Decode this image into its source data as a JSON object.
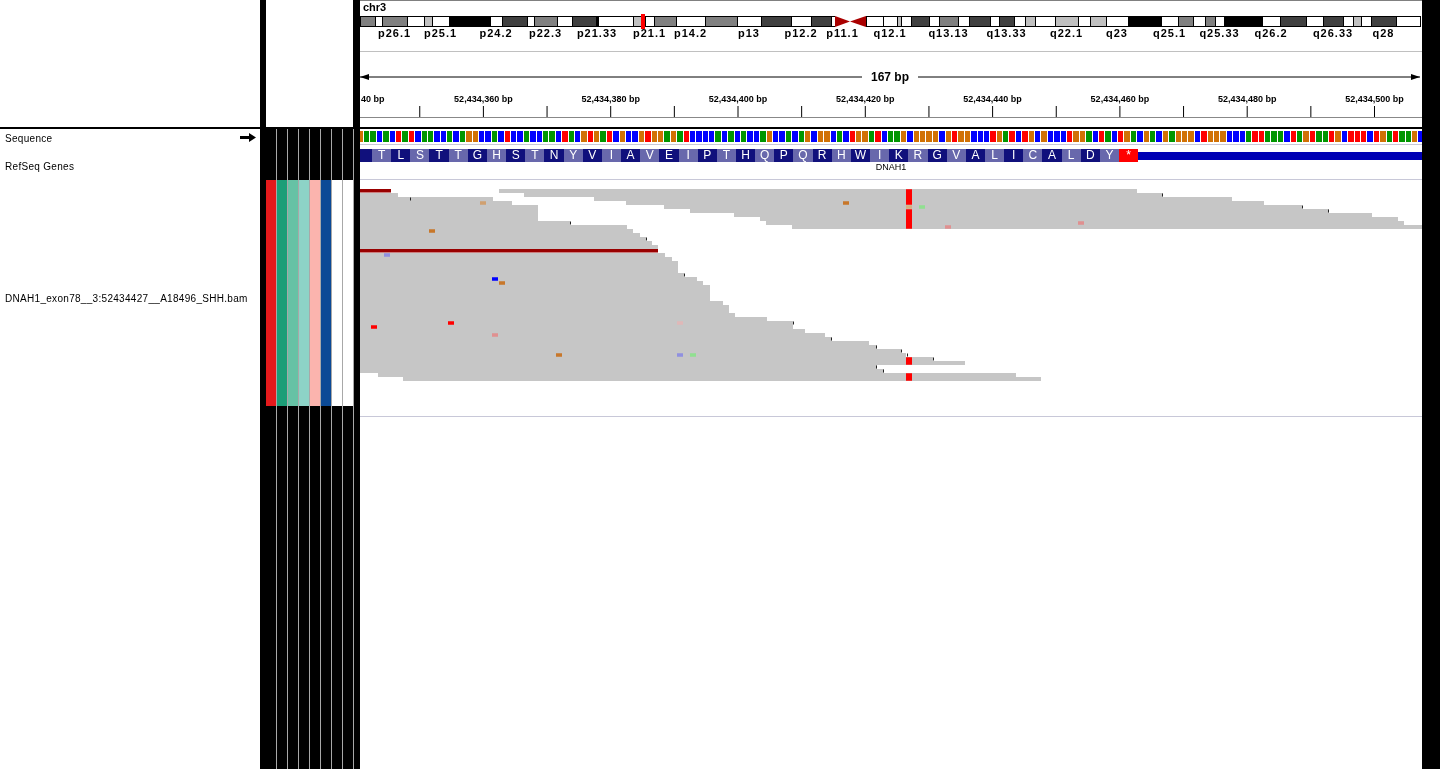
{
  "ideogram": {
    "chromosome": "chr3",
    "bands": [
      {
        "kind": "band",
        "color": "#808080"
      },
      {
        "kind": "band",
        "color": "#ffffff"
      },
      {
        "kind": "band",
        "color": "#808080",
        "label": "p26.1"
      },
      {
        "kind": "band",
        "color": "#ffffff"
      },
      {
        "kind": "band",
        "color": "#c0c0c0"
      },
      {
        "kind": "band",
        "color": "#ffffff",
        "label": "p25.1"
      },
      {
        "kind": "band",
        "color": "#000000"
      },
      {
        "kind": "band",
        "color": "#ffffff",
        "label": "p24.2"
      },
      {
        "kind": "band",
        "color": "#404040"
      },
      {
        "kind": "band",
        "color": "#ffffff"
      },
      {
        "kind": "band",
        "color": "#808080",
        "label": "p22.3"
      },
      {
        "kind": "band",
        "color": "#ffffff"
      },
      {
        "kind": "band",
        "color": "#404040"
      },
      {
        "kind": "band",
        "color": "#000000",
        "label": "p21.33"
      },
      {
        "kind": "band",
        "color": "#ffffff"
      },
      {
        "kind": "band",
        "color": "#c0c0c0"
      },
      {
        "kind": "marker",
        "color": "#ff0000"
      },
      {
        "kind": "band",
        "color": "#ffffff",
        "label": "p21.1"
      },
      {
        "kind": "band",
        "color": "#808080"
      },
      {
        "kind": "band",
        "color": "#ffffff",
        "label": "p14.2"
      },
      {
        "kind": "band",
        "color": "#808080"
      },
      {
        "kind": "band",
        "color": "#ffffff",
        "label": "p13"
      },
      {
        "kind": "band",
        "color": "#404040"
      },
      {
        "kind": "band",
        "color": "#ffffff",
        "label": "p12.2"
      },
      {
        "kind": "band",
        "color": "#404040"
      },
      {
        "kind": "band",
        "color": "#ffffff"
      },
      {
        "kind": "centromere_p",
        "color": "#aa0000",
        "label": "p11.1"
      },
      {
        "kind": "centromere_q",
        "color": "#aa0000"
      },
      {
        "kind": "band",
        "color": "#ffffff"
      },
      {
        "kind": "band",
        "color": "#ffffff",
        "label": "q12.1"
      },
      {
        "kind": "band",
        "color": "#c0c0c0"
      },
      {
        "kind": "band",
        "color": "#ffffff"
      },
      {
        "kind": "band",
        "color": "#404040"
      },
      {
        "kind": "band",
        "color": "#ffffff"
      },
      {
        "kind": "band",
        "color": "#808080",
        "label": "q13.13"
      },
      {
        "kind": "band",
        "color": "#ffffff"
      },
      {
        "kind": "band",
        "color": "#404040"
      },
      {
        "kind": "band",
        "color": "#ffffff"
      },
      {
        "kind": "band",
        "color": "#404040",
        "label": "q13.33"
      },
      {
        "kind": "band",
        "color": "#ffffff"
      },
      {
        "kind": "band",
        "color": "#c0c0c0"
      },
      {
        "kind": "band",
        "color": "#ffffff"
      },
      {
        "kind": "band",
        "color": "#c0c0c0",
        "label": "q22.1"
      },
      {
        "kind": "band",
        "color": "#ffffff"
      },
      {
        "kind": "band",
        "color": "#c0c0c0"
      },
      {
        "kind": "band",
        "color": "#ffffff",
        "label": "q23"
      },
      {
        "kind": "band",
        "color": "#000000"
      },
      {
        "kind": "band",
        "color": "#ffffff",
        "label": "q25.1"
      },
      {
        "kind": "band",
        "color": "#808080"
      },
      {
        "kind": "band",
        "color": "#ffffff"
      },
      {
        "kind": "band",
        "color": "#808080"
      },
      {
        "kind": "band",
        "color": "#ffffff",
        "label": "q25.33"
      },
      {
        "kind": "band",
        "color": "#000000"
      },
      {
        "kind": "band",
        "color": "#ffffff",
        "label": "q26.2"
      },
      {
        "kind": "band",
        "color": "#404040"
      },
      {
        "kind": "band",
        "color": "#ffffff"
      },
      {
        "kind": "band",
        "color": "#404040",
        "label": "q26.33"
      },
      {
        "kind": "band",
        "color": "#ffffff"
      },
      {
        "kind": "band",
        "color": "#c0c0c0"
      },
      {
        "kind": "band",
        "color": "#ffffff"
      },
      {
        "kind": "band",
        "color": "#404040",
        "label": "q28"
      },
      {
        "kind": "band",
        "color": "#ffffff"
      }
    ]
  },
  "ruler": {
    "span": "167 bp",
    "ticks": [
      "40 bp",
      "52,434,360 bp",
      "52,434,380 bp",
      "52,434,400 bp",
      "52,434,420 bp",
      "52,434,440 bp",
      "52,434,460 bp",
      "52,434,480 bp",
      "52,434,500 bp"
    ]
  },
  "sequence_track": {
    "name": "Sequence",
    "forward_strand": true,
    "bases": [
      {
        "color": "#d17105"
      },
      {
        "color": "#009600"
      },
      {
        "color": "#009600"
      },
      {
        "color": "#0000ff"
      },
      {
        "color": "#009600"
      },
      {
        "color": "#0000ff"
      },
      {
        "color": "#ff0000"
      },
      {
        "color": "#009600"
      },
      {
        "color": "#ff0000"
      },
      {
        "color": "#0000ff"
      },
      {
        "color": "#009600"
      },
      {
        "color": "#009600"
      },
      {
        "color": "#0000ff"
      },
      {
        "color": "#0000ff"
      },
      {
        "color": "#009600"
      },
      {
        "color": "#0000ff"
      },
      {
        "color": "#009600"
      },
      {
        "color": "#d17105"
      },
      {
        "color": "#d17105"
      },
      {
        "color": "#0000ff"
      },
      {
        "color": "#0000ff"
      },
      {
        "color": "#009600"
      },
      {
        "color": "#0000ff"
      },
      {
        "color": "#ff0000"
      },
      {
        "color": "#0000ff"
      },
      {
        "color": "#0000ff"
      },
      {
        "color": "#009600"
      },
      {
        "color": "#0000ff"
      },
      {
        "color": "#0000ff"
      },
      {
        "color": "#009600"
      },
      {
        "color": "#009600"
      },
      {
        "color": "#0000ff"
      },
      {
        "color": "#ff0000"
      },
      {
        "color": "#009600"
      },
      {
        "color": "#0000ff"
      },
      {
        "color": "#d17105"
      },
      {
        "color": "#ff0000"
      },
      {
        "color": "#d17105"
      },
      {
        "color": "#009600"
      },
      {
        "color": "#ff0000"
      },
      {
        "color": "#0000ff"
      },
      {
        "color": "#d17105"
      },
      {
        "color": "#0000ff"
      },
      {
        "color": "#0000ff"
      },
      {
        "color": "#d17105"
      },
      {
        "color": "#ff0000"
      },
      {
        "color": "#d17105"
      },
      {
        "color": "#d17105"
      },
      {
        "color": "#009600"
      },
      {
        "color": "#d17105"
      },
      {
        "color": "#009600"
      },
      {
        "color": "#ff0000"
      },
      {
        "color": "#0000ff"
      },
      {
        "color": "#0000ff"
      },
      {
        "color": "#0000ff"
      },
      {
        "color": "#0000ff"
      },
      {
        "color": "#009600"
      },
      {
        "color": "#0000ff"
      },
      {
        "color": "#009600"
      },
      {
        "color": "#0000ff"
      },
      {
        "color": "#009600"
      },
      {
        "color": "#0000ff"
      },
      {
        "color": "#0000ff"
      },
      {
        "color": "#009600"
      },
      {
        "color": "#d17105"
      },
      {
        "color": "#0000ff"
      },
      {
        "color": "#0000ff"
      },
      {
        "color": "#009600"
      },
      {
        "color": "#0000ff"
      },
      {
        "color": "#009600"
      },
      {
        "color": "#d17105"
      },
      {
        "color": "#0000ff"
      },
      {
        "color": "#d17105"
      },
      {
        "color": "#d17105"
      },
      {
        "color": "#0000ff"
      },
      {
        "color": "#009600"
      },
      {
        "color": "#0000ff"
      },
      {
        "color": "#ff0000"
      },
      {
        "color": "#d17105"
      },
      {
        "color": "#d17105"
      },
      {
        "color": "#009600"
      },
      {
        "color": "#ff0000"
      },
      {
        "color": "#0000ff"
      },
      {
        "color": "#009600"
      },
      {
        "color": "#009600"
      },
      {
        "color": "#d17105"
      },
      {
        "color": "#0000ff"
      },
      {
        "color": "#d17105"
      },
      {
        "color": "#d17105"
      },
      {
        "color": "#d17105"
      },
      {
        "color": "#d17105"
      },
      {
        "color": "#0000ff"
      },
      {
        "color": "#d17105"
      },
      {
        "color": "#ff0000"
      },
      {
        "color": "#d17105"
      },
      {
        "color": "#d17105"
      },
      {
        "color": "#0000ff"
      },
      {
        "color": "#0000ff"
      },
      {
        "color": "#0000ff"
      },
      {
        "color": "#ff0000"
      },
      {
        "color": "#d17105"
      },
      {
        "color": "#009600"
      },
      {
        "color": "#ff0000"
      },
      {
        "color": "#0000ff"
      },
      {
        "color": "#ff0000"
      },
      {
        "color": "#d17105"
      },
      {
        "color": "#0000ff"
      },
      {
        "color": "#d17105"
      },
      {
        "color": "#0000ff"
      },
      {
        "color": "#0000ff"
      },
      {
        "color": "#0000ff"
      },
      {
        "color": "#ff0000"
      },
      {
        "color": "#d17105"
      },
      {
        "color": "#d17105"
      },
      {
        "color": "#009600"
      },
      {
        "color": "#0000ff"
      },
      {
        "color": "#ff0000"
      },
      {
        "color": "#009600"
      },
      {
        "color": "#0000ff"
      },
      {
        "color": "#ff0000"
      },
      {
        "color": "#d17105"
      },
      {
        "color": "#009600"
      },
      {
        "color": "#0000ff"
      },
      {
        "color": "#d17105"
      },
      {
        "color": "#009600"
      },
      {
        "color": "#0000ff"
      },
      {
        "color": "#d17105"
      },
      {
        "color": "#009600"
      },
      {
        "color": "#d17105"
      },
      {
        "color": "#d17105"
      },
      {
        "color": "#d17105"
      },
      {
        "color": "#0000ff"
      },
      {
        "color": "#ff0000"
      },
      {
        "color": "#d17105"
      },
      {
        "color": "#d17105"
      },
      {
        "color": "#d17105"
      },
      {
        "color": "#0000ff"
      },
      {
        "color": "#0000ff"
      },
      {
        "color": "#0000ff"
      },
      {
        "color": "#009600"
      },
      {
        "color": "#ff0000"
      },
      {
        "color": "#ff0000"
      },
      {
        "color": "#009600"
      },
      {
        "color": "#009600"
      },
      {
        "color": "#009600"
      },
      {
        "color": "#0000ff"
      },
      {
        "color": "#ff0000"
      },
      {
        "color": "#009600"
      },
      {
        "color": "#d17105"
      },
      {
        "color": "#ff0000"
      },
      {
        "color": "#009600"
      },
      {
        "color": "#009600"
      },
      {
        "color": "#ff0000"
      },
      {
        "color": "#d17105"
      },
      {
        "color": "#0000ff"
      },
      {
        "color": "#ff0000"
      },
      {
        "color": "#ff0000"
      },
      {
        "color": "#ff0000"
      },
      {
        "color": "#0000ff"
      },
      {
        "color": "#ff0000"
      },
      {
        "color": "#d17105"
      },
      {
        "color": "#009600"
      },
      {
        "color": "#ff0000"
      },
      {
        "color": "#009600"
      },
      {
        "color": "#009600"
      },
      {
        "color": "#d17105"
      },
      {
        "color": "#0000ff"
      }
    ]
  },
  "gene_track": {
    "name": "RefSeq Genes",
    "gene": "DNAH1",
    "amino_acids": [
      "T",
      "L",
      "S",
      "T",
      "T",
      "G",
      "H",
      "S",
      "T",
      "N",
      "Y",
      "V",
      "I",
      "A",
      "V",
      "E",
      "I",
      "P",
      "T",
      "H",
      "Q",
      "P",
      "Q",
      "R",
      "H",
      "W",
      "I",
      "K",
      "R",
      "G",
      "V",
      "A",
      "L",
      "I",
      "C",
      "A",
      "L",
      "D",
      "Y"
    ],
    "stop_codon": "*"
  },
  "alignment_track": {
    "name": "DNAH1_exon78__3:52434427__A18496_SHH.bam",
    "attributes": [
      {
        "color": "#e41a1c"
      },
      {
        "color": "#1b9e77"
      },
      {
        "color": "#66c2a5"
      },
      {
        "color": "#8dd3c7"
      },
      {
        "color": "#fbb4ae"
      },
      {
        "color": "#0b4a96"
      },
      {
        "color": "#ffffff"
      },
      {
        "color": "#ffffff"
      }
    ]
  }
}
